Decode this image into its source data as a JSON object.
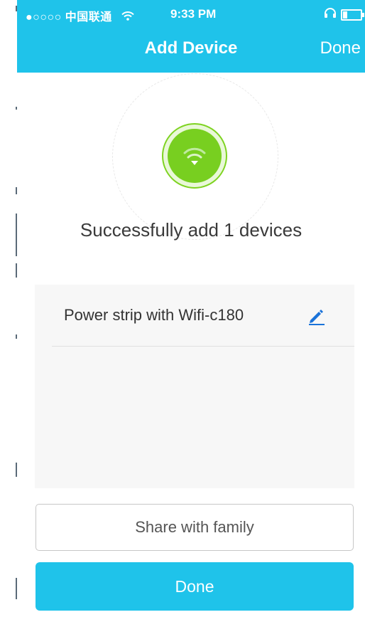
{
  "status_bar": {
    "carrier": "●○○○○ 中国联通",
    "time": "9:33 PM"
  },
  "header": {
    "title": "Add Device",
    "done_label": "Done"
  },
  "result": {
    "message": "Successfully add 1 devices"
  },
  "devices": [
    {
      "name": "Power strip with Wifi-c180"
    }
  ],
  "actions": {
    "share_label": "Share with family",
    "done_label": "Done"
  },
  "colors": {
    "accent": "#1fc3ea",
    "success_green": "#78cf20",
    "edit_blue": "#1a73d9"
  }
}
